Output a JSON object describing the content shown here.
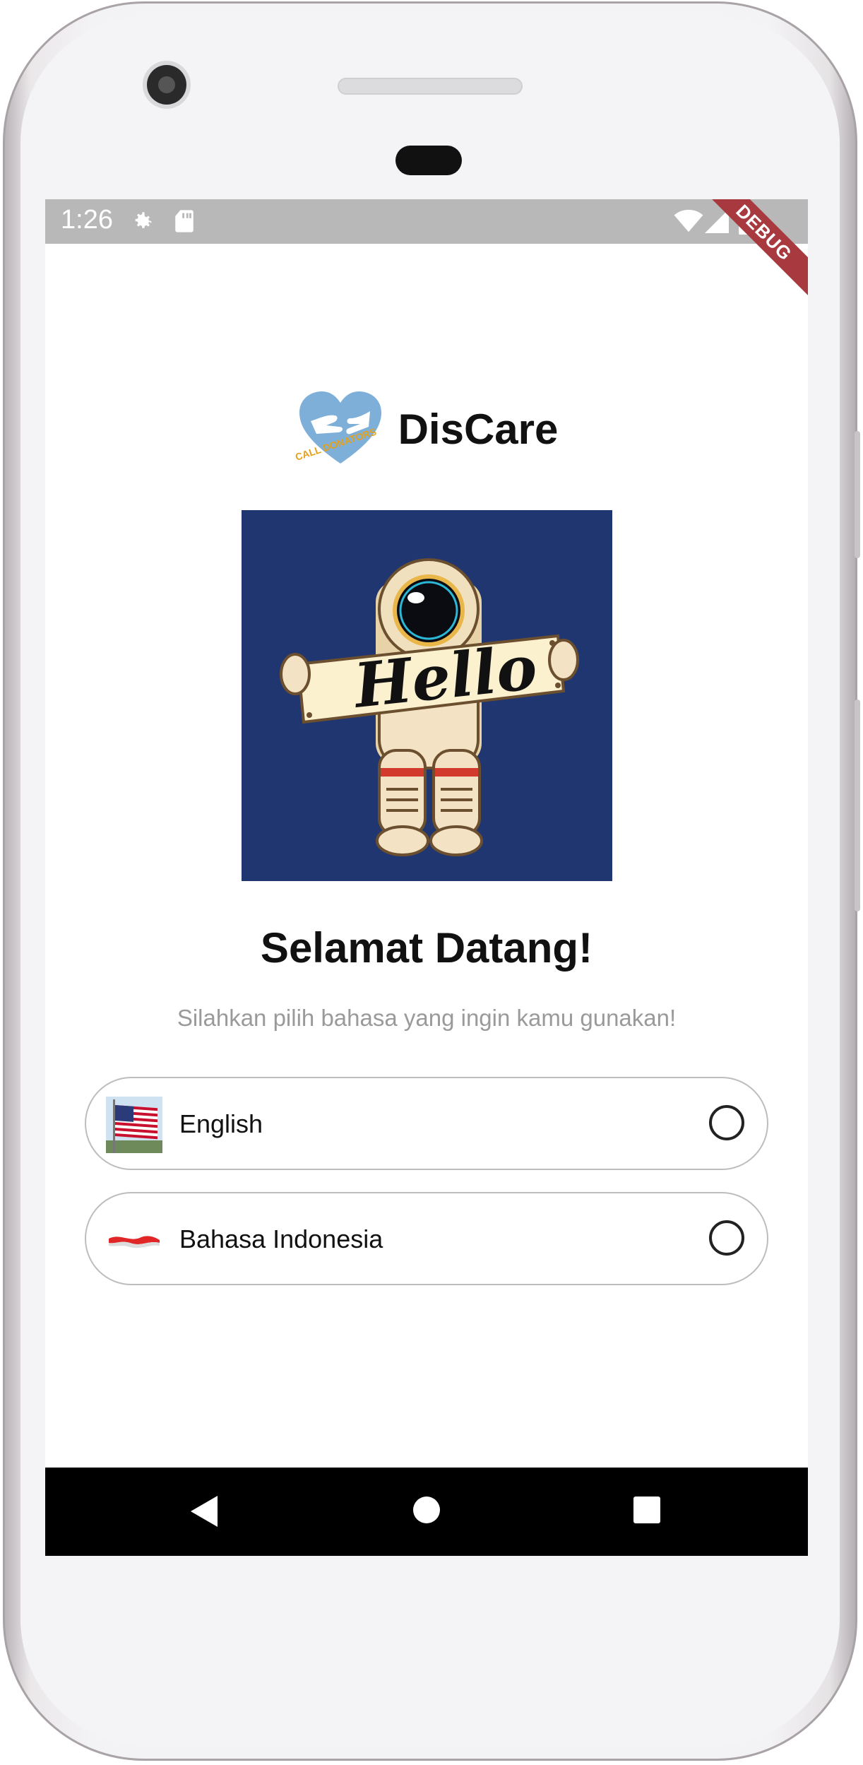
{
  "status_bar": {
    "time": "1:26",
    "icons": [
      "settings-icon",
      "sd-card-icon",
      "wifi-icon",
      "signal-icon",
      "battery-icon"
    ],
    "debug_banner": "DEBUG"
  },
  "header": {
    "logo_text": "CALL DONATORS",
    "app_name": "DisCare"
  },
  "hero": {
    "sign_text": "Hello"
  },
  "welcome": {
    "title": "Selamat Datang!",
    "subtitle": "Silahkan pilih bahasa yang ingin kamu gunakan!"
  },
  "languages": [
    {
      "label": "English",
      "flag": "us-flag-icon",
      "selected": false
    },
    {
      "label": "Bahasa Indonesia",
      "flag": "indonesia-flag-icon",
      "selected": false
    }
  ],
  "nav_bar": {
    "buttons": [
      "back-icon",
      "home-icon",
      "recents-icon"
    ]
  },
  "colors": {
    "hero_background": "#1f3670",
    "option_border": "#bdbdbd",
    "subtitle": "#9a9a9a",
    "debug_banner": "#a83a3f"
  }
}
